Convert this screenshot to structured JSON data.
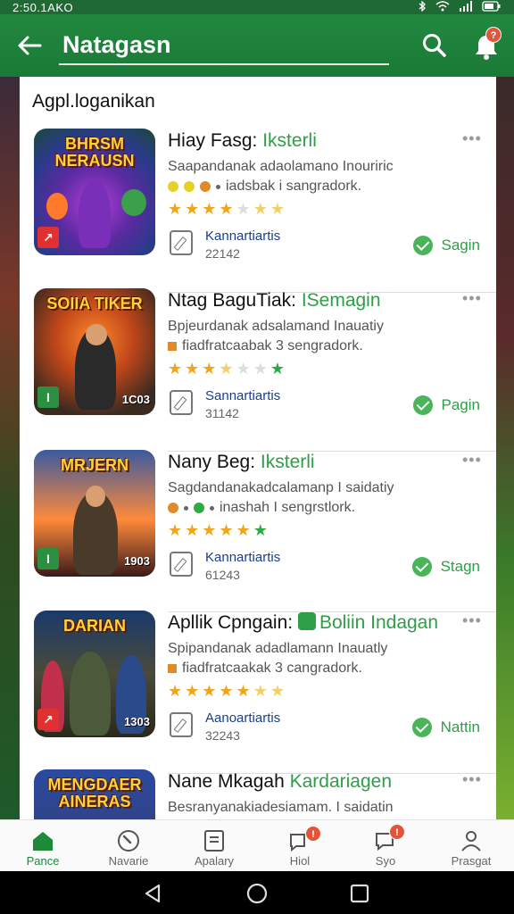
{
  "status_bar": {
    "time": "2:50.1AKO"
  },
  "app_bar": {
    "title": "Natagasn",
    "notification_badge": "?"
  },
  "section": {
    "title": "Agpl.loganikan"
  },
  "apps": [
    {
      "tile_title": "BHRSM NERAUSN",
      "tile_logo": "↗",
      "tile_logo_style": "red",
      "tile_number": "",
      "name": "Hiay Fasg:",
      "name_tag": "Iksterli",
      "description": "Saapandanak adaolamano Inouriric",
      "meta_text": "iadsbak i sangradork.",
      "rating": 4.5,
      "sub_title": "Kannartiartis",
      "sub_number": "22142",
      "action_label": "Sagin",
      "colors": {
        "dot1": "#e6d12a",
        "dot2": "#e6d12a",
        "dot3": "#e08a2a"
      }
    },
    {
      "tile_title": "SOIIA TIKER",
      "tile_logo": "I",
      "tile_logo_style": "green",
      "tile_number": "1C03",
      "name": "Ntag BaguTiak:",
      "name_tag": "ISemagin",
      "description": "Bpjeurdanak adsalamand Inauatiy",
      "meta_text": "fiadfratcaabak 3 sengradork.",
      "rating": 3.5,
      "sub_title": "Sannartiartis",
      "sub_number": "31142",
      "action_label": "Pagin",
      "colors": {
        "dot1": "#e08a2a"
      }
    },
    {
      "tile_title": "MRJERN",
      "tile_logo": "I",
      "tile_logo_style": "green",
      "tile_number": "1903",
      "name": "Nany Beg:",
      "name_tag": "Iksterli",
      "description": "Sagdandanakadcalamanp I saidatiy",
      "meta_text": "inashah I sengrstlork.",
      "rating": 5,
      "sub_title": "Kannartiartis",
      "sub_number": "61243",
      "action_label": "Stagn",
      "colors": {
        "dot1": "#e08a2a",
        "dot2": "#2eaa44",
        "dot3": "#2eaa44"
      }
    },
    {
      "tile_title": "DARIAN",
      "tile_logo": "↗",
      "tile_logo_style": "red",
      "tile_number": "1303",
      "name": "Apllik Cpngain:",
      "name_tag": "Boliin Indagan",
      "description": "Spipandanak adadlamann Inauatly",
      "meta_text": "fiadfratcaakak 3 cangradork.",
      "rating": 4.5,
      "sub_title": "Aanoartiartis",
      "sub_number": "32243",
      "action_label": "Nattin",
      "colors": {
        "dot1": "#e08a2a"
      }
    },
    {
      "tile_title": "MENGDAER AINERAS",
      "tile_logo": "",
      "tile_logo_style": "red",
      "tile_number": "",
      "name": "Nane Mkagah",
      "name_tag": "Kardariagen",
      "description": "Besranyanakiadesiamam. I saidatin",
      "meta_text": "",
      "rating": 0,
      "sub_title": "",
      "sub_number": "",
      "action_label": "",
      "colors": {}
    }
  ],
  "bottom_nav": [
    {
      "label": "Pance",
      "icon": "home-icon",
      "active": true
    },
    {
      "label": "Navarie",
      "icon": "compass-icon",
      "active": false
    },
    {
      "label": "Apalary",
      "icon": "document-icon",
      "active": false
    },
    {
      "label": "Hiol",
      "icon": "chat-bubble-icon",
      "active": false
    },
    {
      "label": "Syo",
      "icon": "message-icon",
      "active": false
    },
    {
      "label": "Prasgat",
      "icon": "person-icon",
      "active": false
    }
  ],
  "theme": {
    "primary": "#1f7f3a",
    "accent": "#2e9e48",
    "badge": "#e2553a"
  }
}
